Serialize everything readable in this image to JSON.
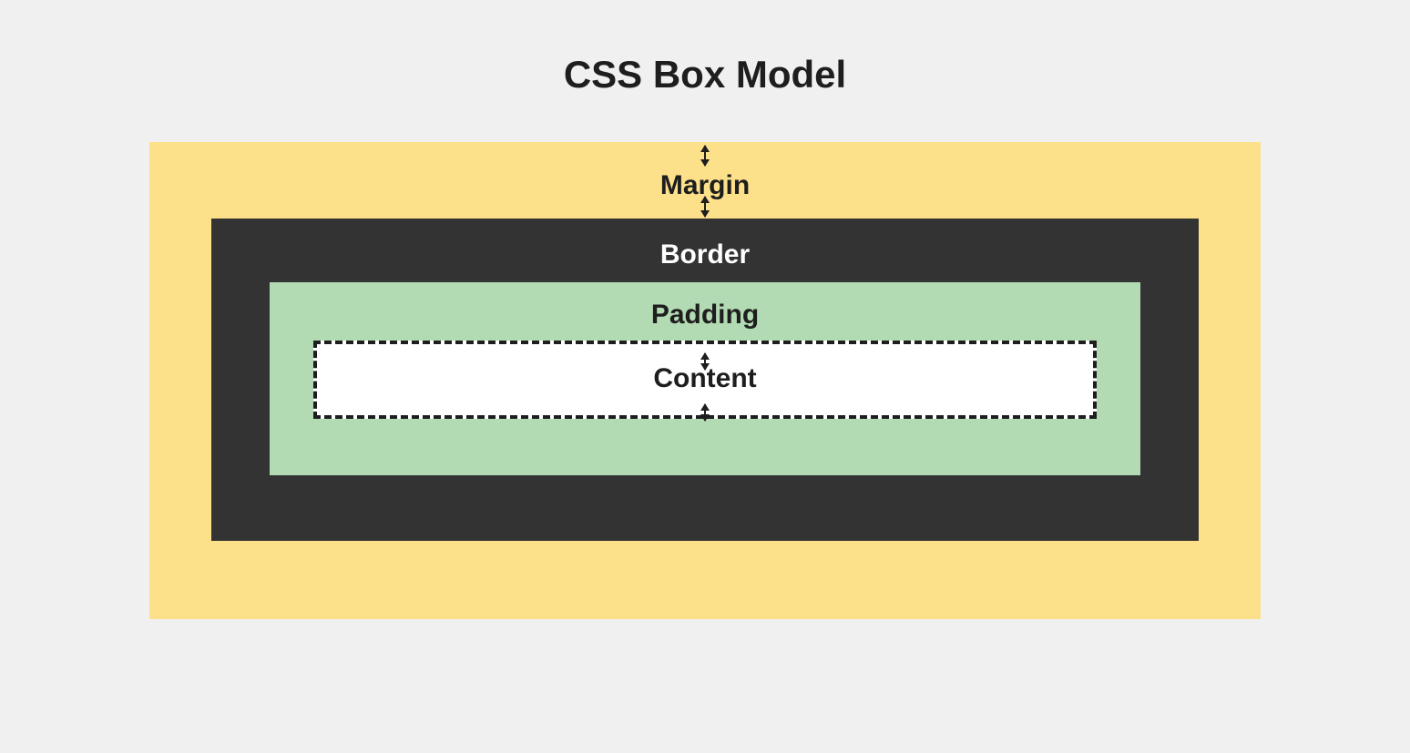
{
  "title": "CSS Box Model",
  "layers": {
    "margin": {
      "label": "Margin",
      "color": "#fde18a"
    },
    "border": {
      "label": "Border",
      "color": "#333333"
    },
    "padding": {
      "label": "Padding",
      "color": "#b3dbb3"
    },
    "content": {
      "label": "Content",
      "color": "#ffffff"
    }
  },
  "arrows": {
    "margin": {
      "top": true,
      "bottom": true
    },
    "content": {
      "top": true,
      "bottom": true
    }
  }
}
